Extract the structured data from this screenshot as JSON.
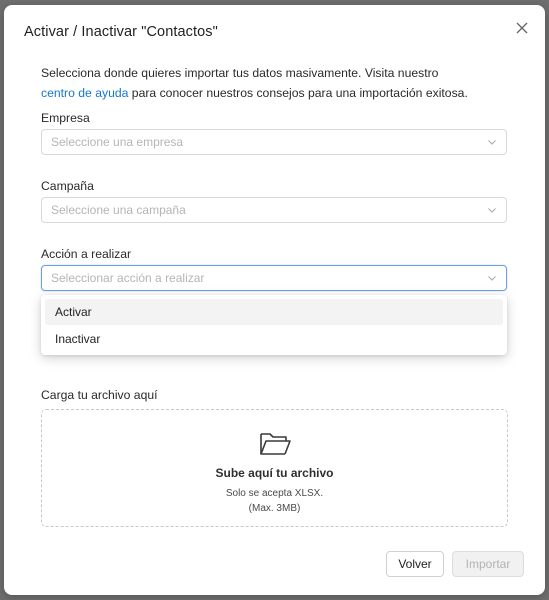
{
  "modal": {
    "title": "Activar / Inactivar \"Contactos\""
  },
  "intro": {
    "line1": "Selecciona donde quieres importar tus datos masivamente. Visita nuestro",
    "link": "centro de ayuda",
    "line2_rest": " para conocer nuestros consejos para una importación exitosa."
  },
  "fields": {
    "empresa": {
      "label": "Empresa",
      "placeholder": "Seleccione una empresa"
    },
    "campana": {
      "label": "Campaña",
      "placeholder": "Seleccione una campaña"
    },
    "accion": {
      "label": "Acción a realizar",
      "placeholder": "Seleccionar acción a realizar"
    }
  },
  "dropdown": {
    "options": [
      "Activar",
      "Inactivar"
    ],
    "highlighted": "Activar"
  },
  "upload": {
    "label": "Carga tu archivo aquí",
    "title": "Sube aquí tu archivo",
    "accepts": "Solo se acepta XLSX.",
    "max": "(Max. 3MB)",
    "icon": "folder-open-icon"
  },
  "buttons": {
    "back": "Volver",
    "import": "Importar"
  },
  "colors": {
    "link": "#1677d2",
    "focus_border": "#6ea0e8",
    "disabled_bg": "#f1f1f1"
  }
}
